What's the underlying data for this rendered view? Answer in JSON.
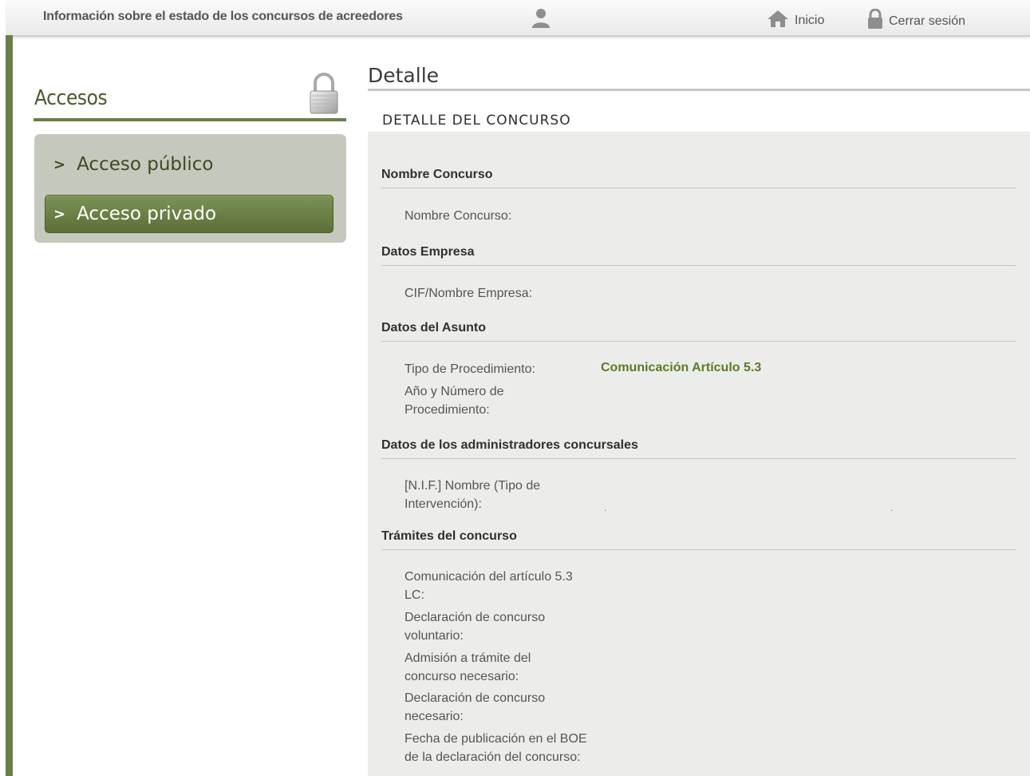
{
  "header": {
    "title": "Información sobre el estado de los concursos de acreedores",
    "user_icon": "user-icon",
    "home_label": "Inicio",
    "home_icon": "home-icon",
    "logout_label": "Cerrar sesión",
    "logout_icon": "lock-icon"
  },
  "sidebar": {
    "title": "Accesos",
    "title_icon": "padlock-icon",
    "items": [
      {
        "label": "Acceso público",
        "active": false
      },
      {
        "label": "Acceso privado",
        "active": true
      }
    ]
  },
  "main": {
    "heading": "Detalle",
    "section_title": "DETALLE DEL CONCURSO",
    "groups": [
      {
        "title": "Nombre Concurso",
        "fields": [
          {
            "label": "Nombre Concurso:",
            "value": ""
          }
        ]
      },
      {
        "title": "Datos Empresa",
        "fields": [
          {
            "label": "CIF/Nombre Empresa:",
            "value": ""
          }
        ]
      },
      {
        "title": "Datos del Asunto",
        "fields": [
          {
            "label": "Tipo de Procedimiento:",
            "value": "Comunicación Artículo 5.3"
          },
          {
            "label": "Año y Número de Procedimiento:",
            "value": ""
          }
        ]
      },
      {
        "title": "Datos de los administradores concursales",
        "fields": [
          {
            "label": "[N.I.F.] Nombre (Tipo de Intervención):",
            "value": "",
            "dot1": ".",
            "dot2": "."
          }
        ]
      },
      {
        "title": "Trámites del concurso",
        "fields": [
          {
            "label": "Comunicación del artículo 5.3 LC:",
            "value": ""
          },
          {
            "label": "Declaración de concurso voluntario:",
            "value": ""
          },
          {
            "label": "Admisión a trámite del concurso necesario:",
            "value": ""
          },
          {
            "label": "Declaración de concurso necesario:",
            "value": ""
          },
          {
            "label": "Fecha de publicación en el BOE de la declaración del concurso:",
            "value": ""
          }
        ]
      }
    ]
  },
  "colors": {
    "accent_green": "#6b7f48",
    "active_button": "#6a7f45",
    "value_green": "#5c7a2a",
    "panel_bg": "#ecedea"
  }
}
